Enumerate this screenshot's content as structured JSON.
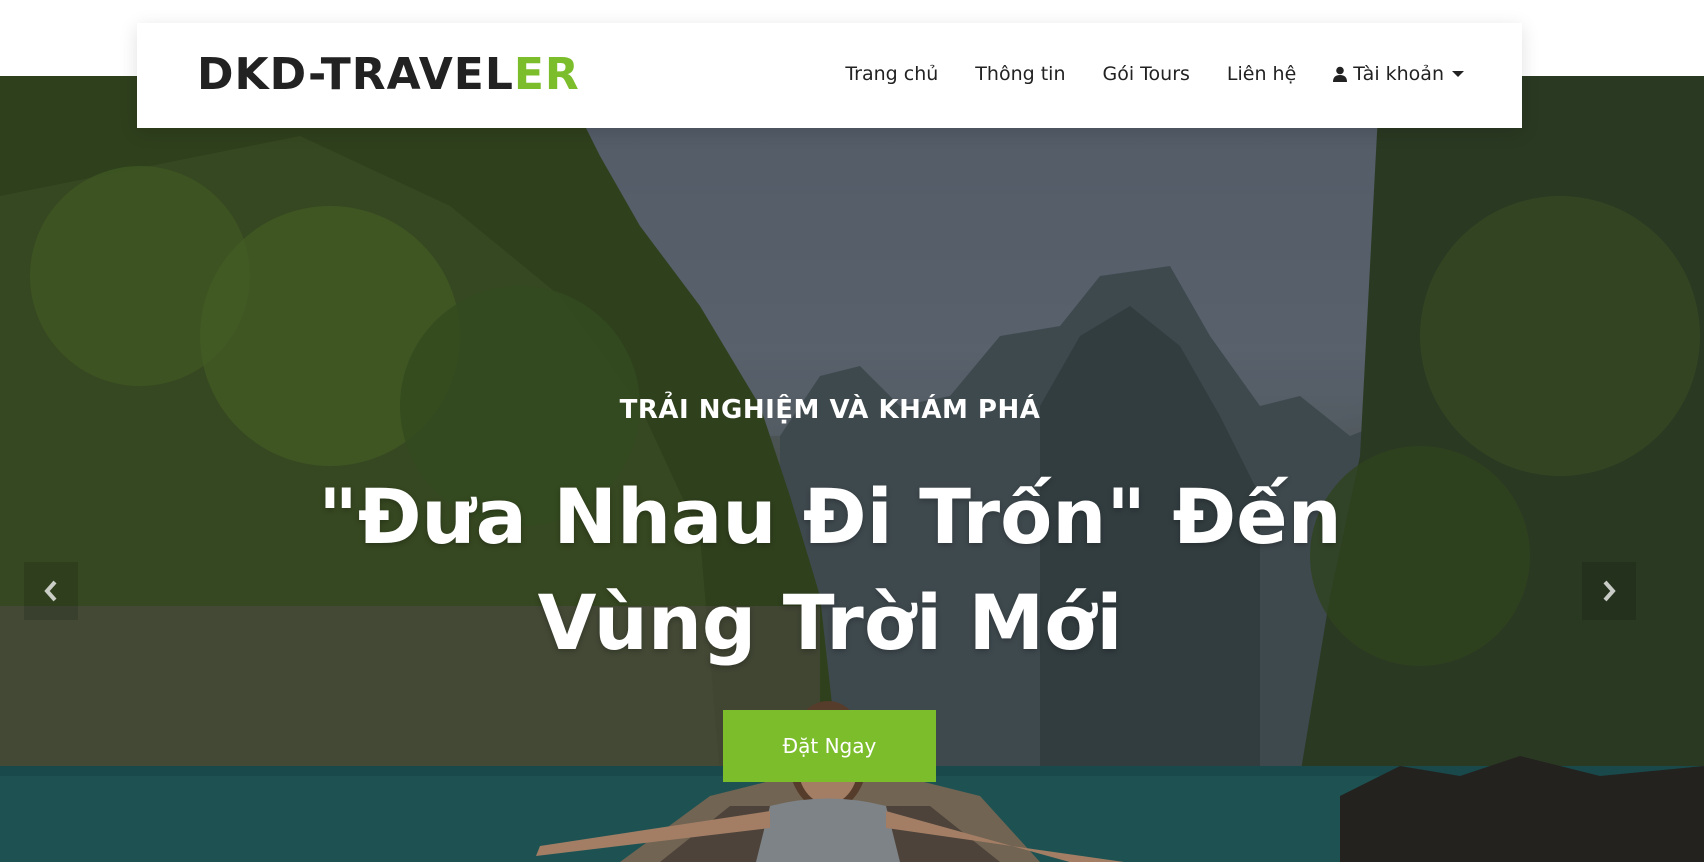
{
  "brand": {
    "main": "DKD-TRAVEL",
    "accent": "ER"
  },
  "nav": {
    "items": [
      "Trang chủ",
      "Thông tin",
      "Gói Tours",
      "Liên hệ"
    ],
    "account": "Tài khoản"
  },
  "hero": {
    "subtitle": "TRẢI NGHIỆM VÀ KHÁM PHÁ",
    "headline_line1": "\"Đưa Nhau Đi Trốn\" Đến",
    "headline_line2": "Vùng Trời Mới",
    "cta": "Đặt Ngay"
  },
  "colors": {
    "accent": "#7cbd2b",
    "text_dark": "#222222"
  },
  "icons": {
    "account": "user-icon",
    "prev": "chevron-left-icon",
    "next": "chevron-right-icon"
  }
}
